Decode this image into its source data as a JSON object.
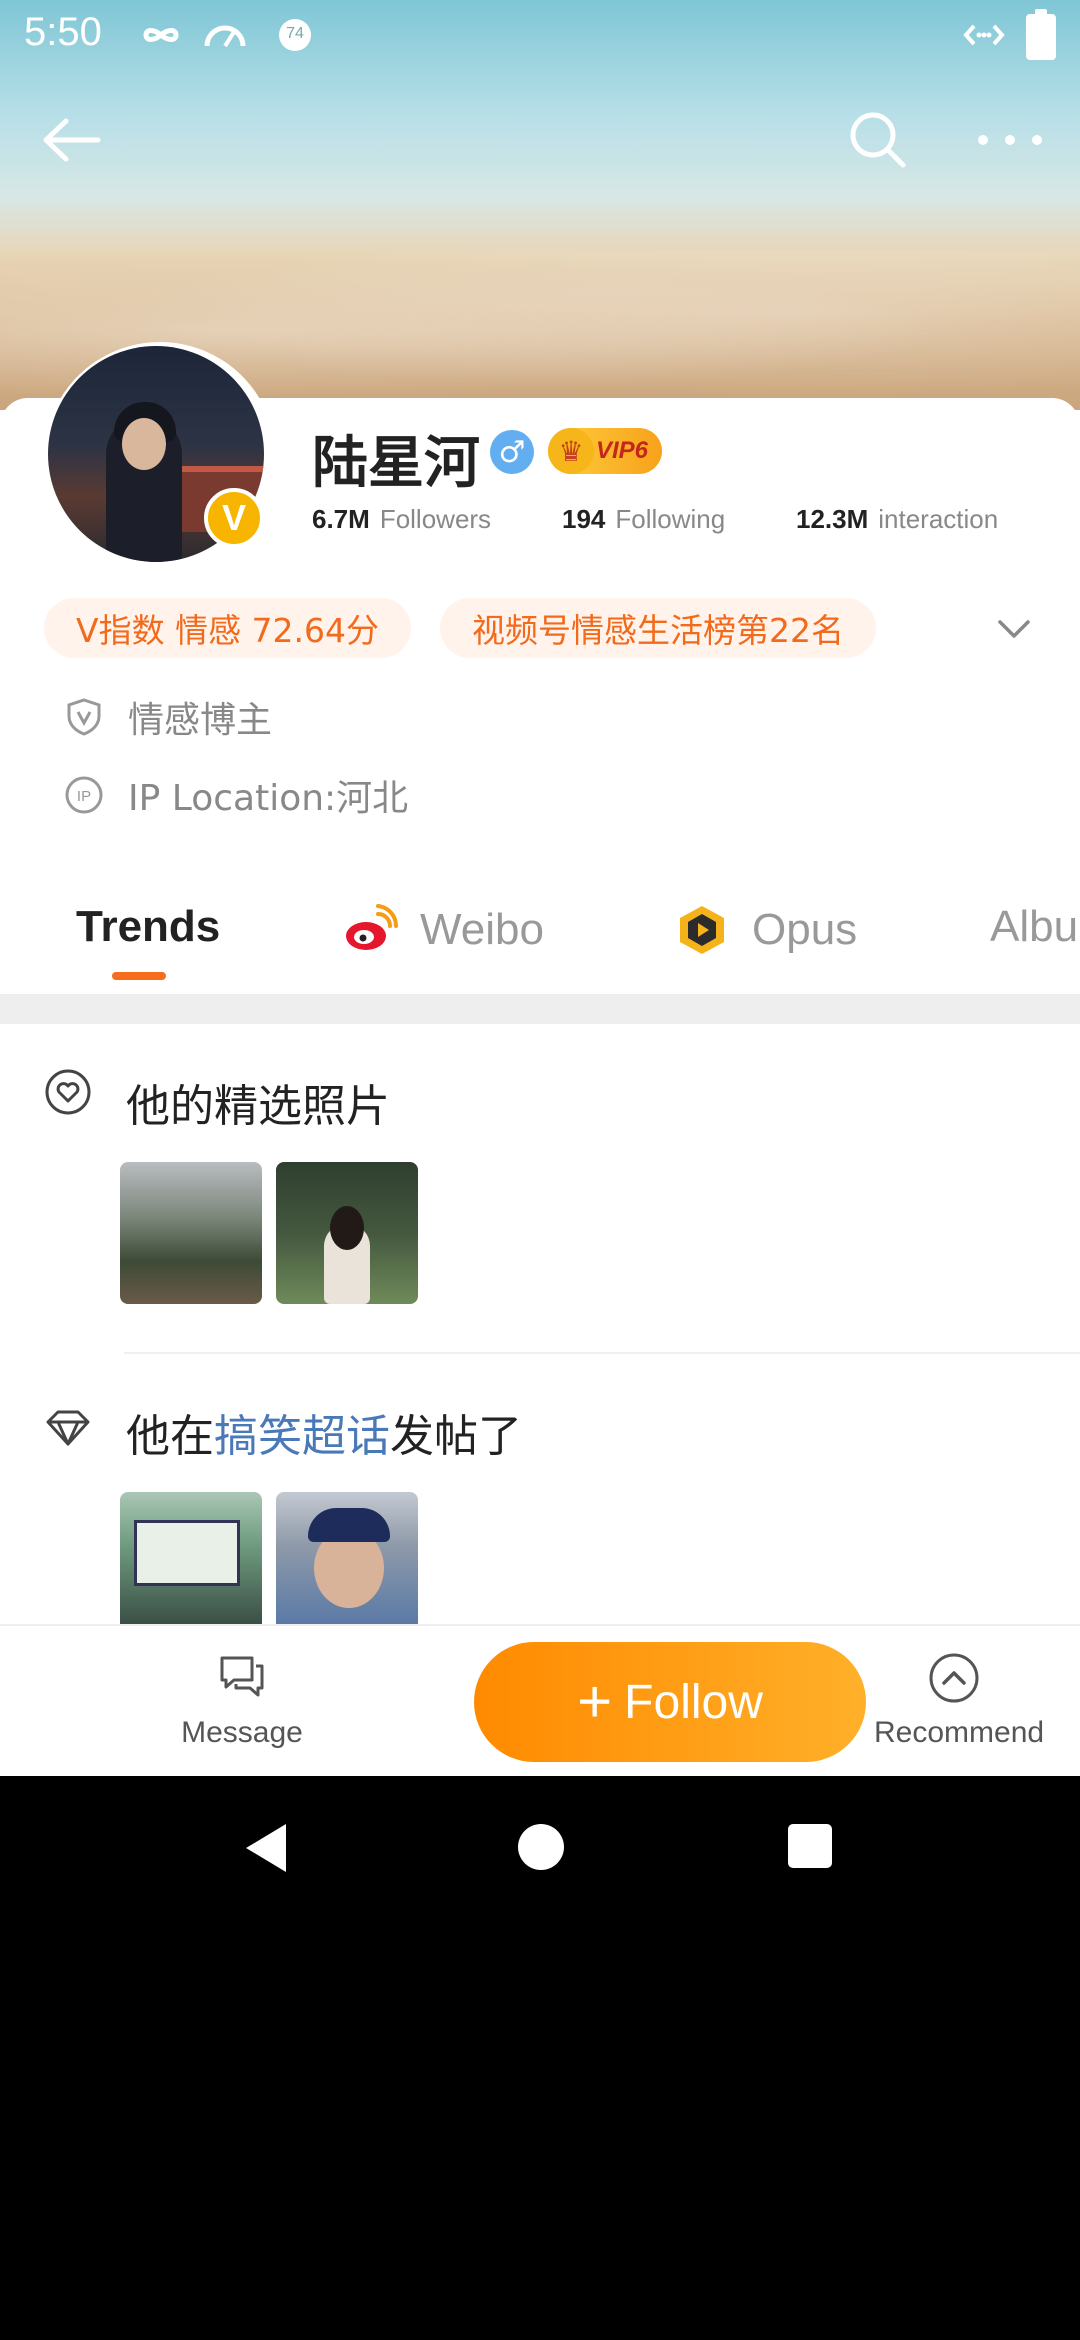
{
  "status_bar": {
    "time": "5:50",
    "badge": "74"
  },
  "profile": {
    "name": "陆星河",
    "gender_symbol": "♂",
    "vip_label": "VIP6",
    "verified_badge": "V",
    "stats": [
      {
        "value": "6.7M",
        "label": "Followers"
      },
      {
        "value": "194",
        "label": "Following"
      },
      {
        "value": "12.3M",
        "label": "interaction"
      }
    ],
    "tags": [
      "V指数 情感 72.64分",
      "视频号情感生活榜第22名"
    ],
    "role": "情感博主",
    "ip_location": "IP Location:河北"
  },
  "tabs": [
    {
      "label": "Trends",
      "active": true
    },
    {
      "label": "Weibo",
      "active": false
    },
    {
      "label": "Opus",
      "active": false
    },
    {
      "label": "Albu",
      "active": false
    }
  ],
  "feed": {
    "section1_title": "他的精选照片",
    "section2_prefix": "他在",
    "section2_link": "搞笑超话",
    "section2_suffix": "发帖了"
  },
  "bottom_bar": {
    "message": "Message",
    "follow": "Follow",
    "follow_plus": "+",
    "recommend": "Recommend"
  },
  "colors": {
    "accent": "#f66d1f",
    "follow_start": "#ff8a00",
    "follow_end": "#ffb029",
    "link": "#4a79b8"
  }
}
